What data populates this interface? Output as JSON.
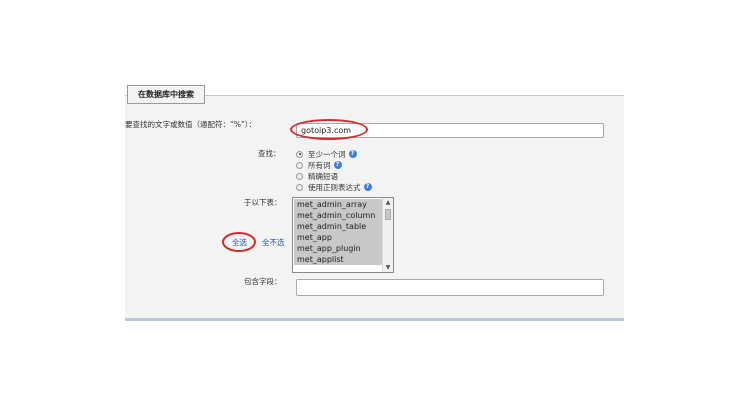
{
  "search_form": {
    "legend": "在数据库中搜索",
    "search_text_label": "要查找的文字或数值（通配符：“%”）：",
    "search_text_value": "gotoip3.com",
    "find_label": "查找：",
    "options": [
      {
        "label": "至少一个词",
        "selected": true,
        "help_icon": true
      },
      {
        "label": "所有词",
        "selected": false,
        "help_icon": true
      },
      {
        "label": "精确短语",
        "selected": false,
        "help_icon": false
      },
      {
        "label": "使用正则表达式",
        "selected": false,
        "help_icon": true
      }
    ],
    "tables_label": "于以下表：",
    "tables": [
      "met_admin_array",
      "met_admin_column",
      "met_admin_table",
      "met_app",
      "met_app_plugin",
      "met_applist"
    ],
    "select_all": "全选",
    "select_none": "全不选",
    "column_label": "包含字段：",
    "column_value": ""
  },
  "colors": {
    "highlight": "#d42b2b",
    "link": "#1f56a8",
    "panel_bg": "#f3f3f3"
  }
}
